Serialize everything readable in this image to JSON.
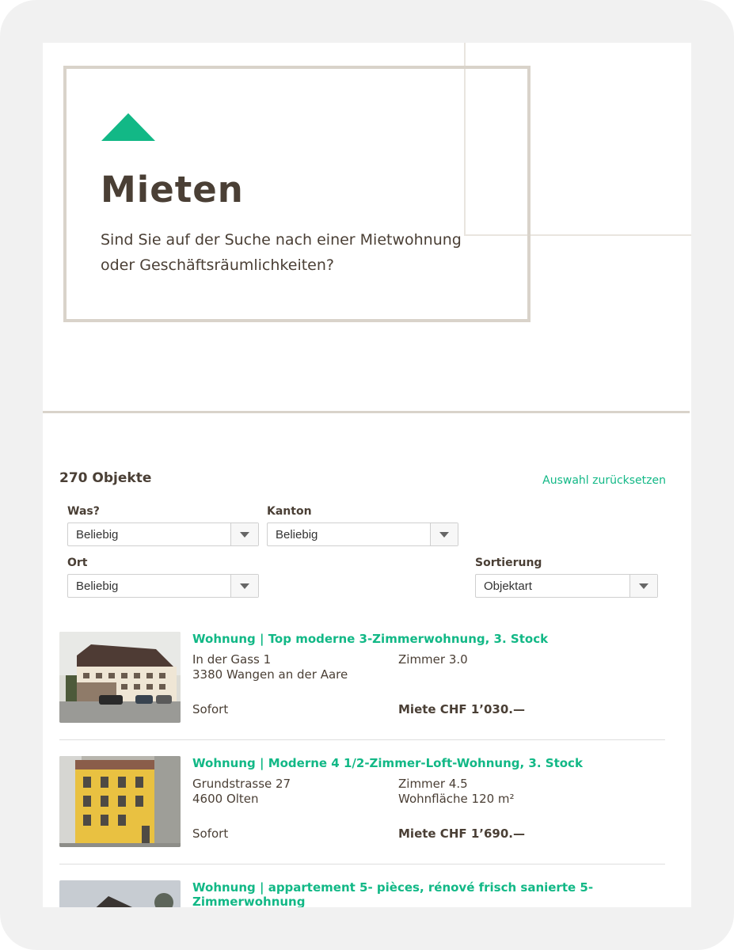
{
  "hero": {
    "title": "Mieten",
    "subtitle": "Sind Sie auf der Suche nach einer Mietwohnung oder Geschäftsräumlichkeiten?",
    "accent_color": "#12b886"
  },
  "results": {
    "count_label": "270 Objekte",
    "reset_label": "Auswahl zurücksetzen"
  },
  "filters": {
    "was": {
      "label": "Was?",
      "value": "Beliebig"
    },
    "kanton": {
      "label": "Kanton",
      "value": "Beliebig"
    },
    "ort": {
      "label": "Ort",
      "value": "Beliebig"
    },
    "sortierung": {
      "label": "Sortierung",
      "value": "Objektart"
    }
  },
  "listings": [
    {
      "title": "Wohnung | Top moderne 3-Zimmerwohnung, 3. Stock",
      "street": "In der Gass 1",
      "city": "3380 Wangen an der Aare",
      "rooms": "Zimmer 3.0",
      "area": "",
      "availability": "Sofort",
      "price": "Miete CHF 1’030.—"
    },
    {
      "title": "Wohnung | Moderne 4 1/2-Zimmer-Loft-Wohnung, 3. Stock",
      "street": "Grundstrasse 27",
      "city": "4600 Olten",
      "rooms": "Zimmer 4.5",
      "area": "Wohnfläche 120 m²",
      "availability": "Sofort",
      "price": "Miete CHF 1’690.—"
    },
    {
      "title": "Wohnung | appartement 5- pièces, rénové frisch sanierte 5-Zimmerwohnung"
    }
  ]
}
